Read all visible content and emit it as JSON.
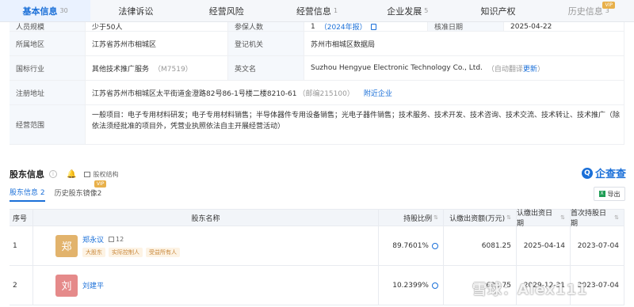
{
  "tabs": [
    {
      "label": "基本信息",
      "count": "30",
      "active": true
    },
    {
      "label": "法律诉讼",
      "count": ""
    },
    {
      "label": "经营风险",
      "count": ""
    },
    {
      "label": "经营信息",
      "count": "1"
    },
    {
      "label": "企业发展",
      "count": "5"
    },
    {
      "label": "知识产权",
      "count": ""
    },
    {
      "label": "历史信息",
      "count": "3",
      "vip": "VIP"
    }
  ],
  "info": {
    "row1": {
      "l1": "人员规模",
      "v1": "少于50人",
      "l2": "参保人数",
      "v2": "1",
      "v2_note": "（2024年报）",
      "l3": "核准日期",
      "v3": "2025-04-22"
    },
    "row2": {
      "l1": "所属地区",
      "v1": "江苏省苏州市相城区",
      "l2": "登记机关",
      "v2": "苏州市相城区数据局"
    },
    "row3": {
      "l1": "国标行业",
      "v1": "其他技术推广服务",
      "v1_note": "（M7519）",
      "l2": "英文名",
      "v2": "Suzhou Hengyue Electronic Technology Co., Ltd.",
      "v2_note": "（自动翻译",
      "v2_link": "更新",
      "v2_close": "）"
    },
    "row4": {
      "l1": "注册地址",
      "v1": "江苏省苏州市相城区太平街道金澄路82号86-1号楼二楼8210-61",
      "v1_note": "（邮编215100）",
      "v1_link": "附近企业"
    },
    "row5": {
      "l1": "经营范围",
      "v1": "一般项目：电子专用材料研发；电子专用材料销售；半导体器件专用设备销售；光电子器件销售；技术服务、技术开发、技术咨询、技术交流、技术转让、技术推广（除依法须经批准的项目外，凭营业执照依法自主开展经营活动）"
    }
  },
  "shareholder": {
    "title": "股东信息",
    "info_icon": "i",
    "structure_label": "股权结构",
    "brand": "企查查",
    "subtabs": [
      {
        "label": "股东信息",
        "count": "2",
        "active": true
      },
      {
        "label": "历史股东镜像",
        "count": "2",
        "vip": "VIP"
      }
    ],
    "export_label": "导出",
    "headers": [
      "序号",
      "股东名称",
      "持股比例",
      "认缴出资额(万元)",
      "认缴出资日期",
      "首次持股日期"
    ],
    "rows": [
      {
        "index": "1",
        "avatar_char": "郑",
        "avatar_color": "#e2b36c",
        "name": "郑永议",
        "count": "12",
        "tags": [
          "大股东",
          "实际控制人",
          "受益所有人"
        ],
        "pct": "89.7601%",
        "amount": "6081.25",
        "date1": "2025-04-14",
        "date2": "2023-07-04"
      },
      {
        "index": "2",
        "avatar_char": "刘",
        "avatar_color": "#e58a8a",
        "name": "刘建平",
        "count": "",
        "tags": [],
        "pct": "10.2399%",
        "amount": "693.75",
        "date1": "2029-12-31",
        "date2": "2023-07-04"
      }
    ]
  },
  "watermark": "雪球：Alex111"
}
